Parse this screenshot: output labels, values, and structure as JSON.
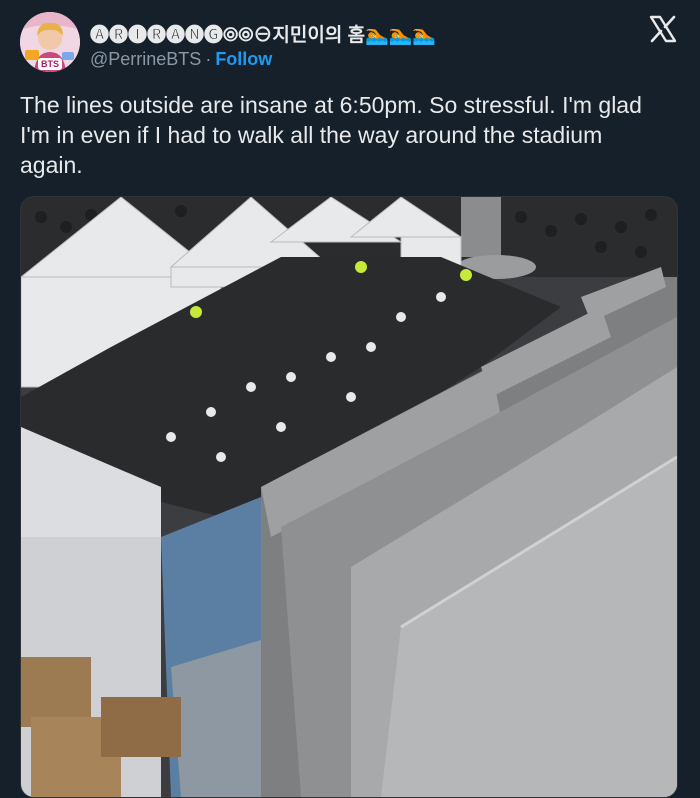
{
  "tweet": {
    "display_name": "🅐🅡🅘🅡🅐🅝🅖⦾⦾⊖지민이의 홈🏊🏊🏊",
    "handle": "@PerrineBTS",
    "separator": "·",
    "follow_label": "Follow",
    "avatar_text": "BTS",
    "text": "The lines outside are insane at 6:50pm. So stressful.  I'm glad I'm in even if I had to walk all the way around the stadium again."
  },
  "icons": {
    "platform_logo": "x-logo-icon"
  },
  "colors": {
    "background": "#15202b",
    "text": "#e7e9ea",
    "secondary_text": "#8b98a5",
    "accent": "#1d9bf0"
  }
}
